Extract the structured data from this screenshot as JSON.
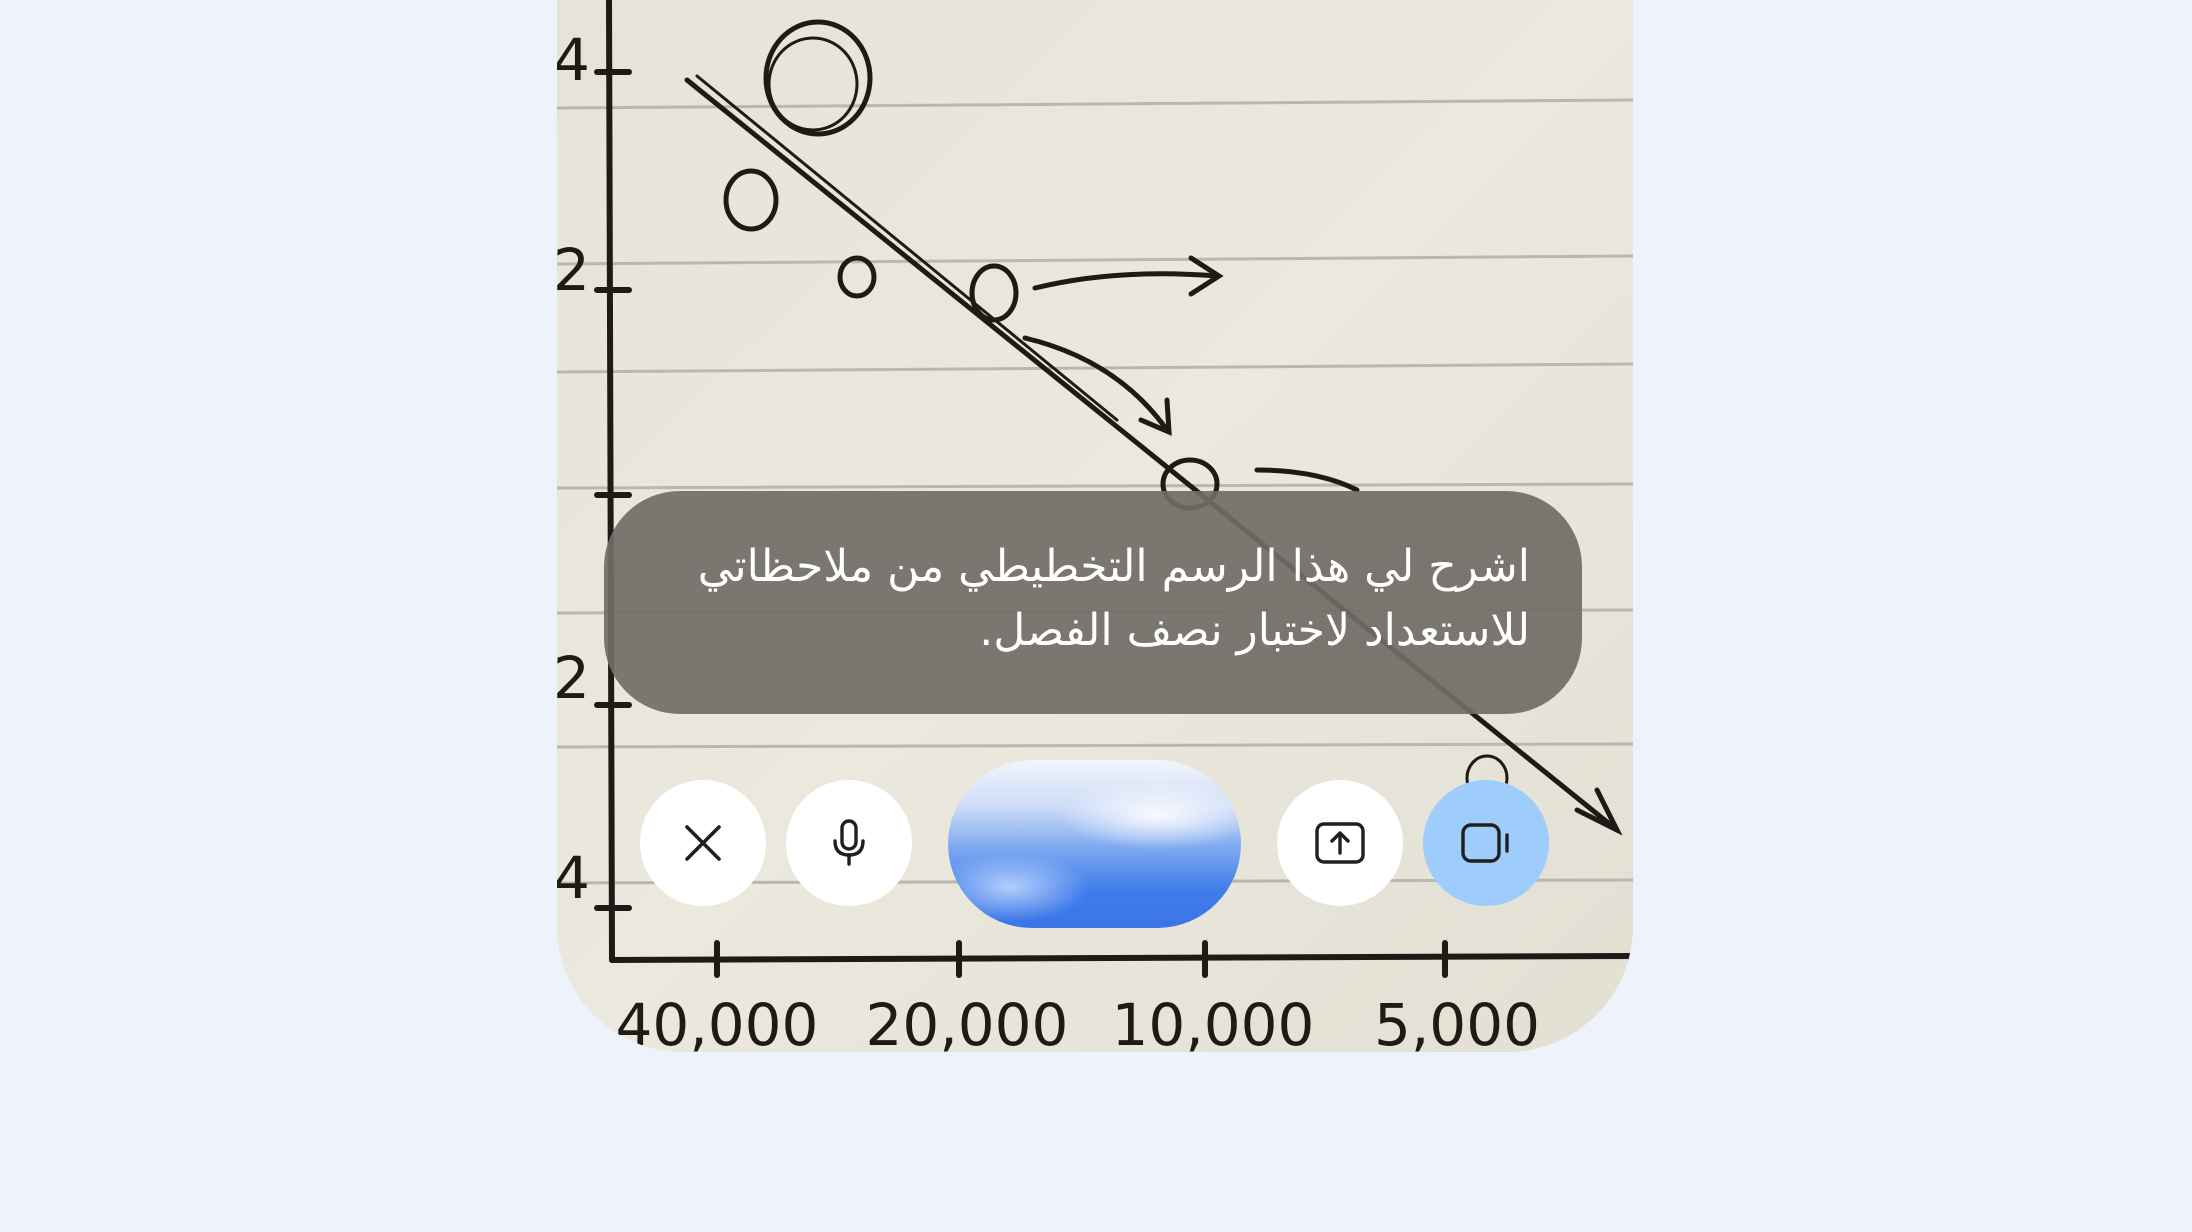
{
  "camera_feed": {
    "tick_labels": {
      "x_40000": "40,000",
      "x_20000": "20,000",
      "x_10000": "10,000",
      "x_5000": "5,000",
      "y_top": "4",
      "y_upper": "2",
      "y_lower": "2",
      "y_bottom": "4"
    }
  },
  "prompt": {
    "text": "اشرح لي هذا الرسم التخطيطي من ملاحظاتي للاستعداد لاختبار نصف الفصل."
  },
  "controls": {
    "close_icon": "close-icon",
    "mic_icon": "microphone-icon",
    "share_icon": "screen-share-icon",
    "camera_icon": "video-camera-icon",
    "camera_active_color": "#9fcdfb",
    "orb_color": "#3f7ce9"
  },
  "colors": {
    "page_background": "#eef2fa",
    "paper": "#e9e6dc",
    "bubble": "#706d66"
  }
}
